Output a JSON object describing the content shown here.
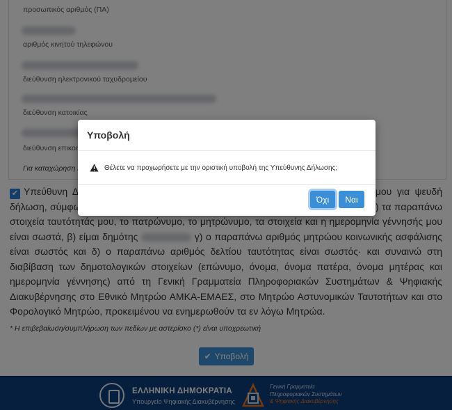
{
  "form": {
    "labels": {
      "pa": "προσωπικός αριθμός (ΠΑ)",
      "mobile": "αριθμός κινητού τηλεφώνου",
      "email": "διεύθυνση ηλεκτρονικού ταχυδρομείου",
      "address": "διεύθυνση κατοικίας",
      "contact": "διεύθυνση επικοινωνίας"
    },
    "hint": "Για καταχώρηση ή",
    "declaration": "Υπεύθυνη Δήλωση: Δηλώνω υπεύθυνα και εν γνώσει των συνεπειών του νόμου για ψευδή δήλωση, σύμφωνα με τις διατάξεις της παρ. 6 του άρθρου 22 του ν.1599/1986, ότι α) τα παραπάνω στοιχεία ταυτότητάς μου, το πατρώνυμο, το μητρώνυμο, τα στοιχεία και η ημερομηνία γέννησής μου είναι σωστά, β) είμαι δημότης",
    "declaration_rest": "γ) ο παραπάνω αριθμός μητρώου κοινωνικής ασφάλισης είναι σωστός και δ) ο παραπάνω αριθμός δελτίου ταυτότητας είναι σωστός· και συναινώ στη διαβίβαση των δημοτολογικών στοιχείων (επώνυμο, όνομα, όνομα πατέρα, όνομα μητέρας και ημερομηνία γέννησης) από τη Γενική Γραμματεία Πληροφοριακών Συστημάτων & Ψηφιακής Διακυβέρνησης στο Εθνικό Μητρώο ΑΜΚΑ-ΕΜΑΕΣ, στο Μητρώο Αστυνομικών Ταυτοτήτων και στο Φορολογικό Μητρώο, προκειμένου να ενημερωθούν τα εν λόγω Μητρώα.",
    "footnote": "* Η επιβεβαίωση/συμπλήρωση των πεδίων με αστερίσκο (*) είναι υποχρεωτική",
    "submit_label": "Υποβολή"
  },
  "footer": {
    "gov_title": "ΕΛΛΗΝΙΚΗ ΔΗΜΟΚΡΑΤΙΑ",
    "gov_subtitle": "Υπουργείο Ψηφιακής Διακυβέρνησης",
    "gg_line1": "Γενική Γραμματεία",
    "gg_line2": "Πληροφοριακών Συστημάτων",
    "gg_line3": "& Ψηφιακής Διακυβέρνησης"
  },
  "modal": {
    "title": "Υποβολή",
    "message": "Θέλετε να προχωρήσετε με την οριστική υποβολή της Υπεύθυνης Δήλωσης;",
    "no_label": "Όχι",
    "yes_label": "Ναι"
  },
  "colors": {
    "primary": "#3b8fd6",
    "footer": "#0f3f7c",
    "accent_orange": "#e87722"
  },
  "icons": [
    "check-icon",
    "warning-icon",
    "greek-emblem-icon",
    "gg-logo-icon"
  ]
}
